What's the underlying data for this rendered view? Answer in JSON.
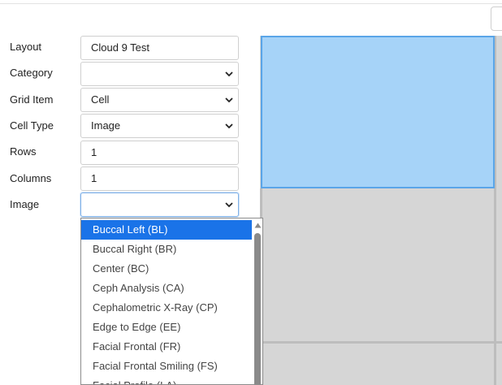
{
  "form": {
    "layout": {
      "label": "Layout",
      "value": "Cloud 9 Test"
    },
    "category": {
      "label": "Category",
      "value": ""
    },
    "grid_item": {
      "label": "Grid Item",
      "value": "Cell"
    },
    "cell_type": {
      "label": "Cell Type",
      "value": "Image"
    },
    "rows": {
      "label": "Rows",
      "value": "1"
    },
    "columns": {
      "label": "Columns",
      "value": "1"
    },
    "image": {
      "label": "Image",
      "value": ""
    }
  },
  "image_dropdown": {
    "options": [
      "Buccal Left (BL)",
      "Buccal Right (BR)",
      "Center (BC)",
      "Ceph Analysis (CA)",
      "Cephalometric X-Ray (CP)",
      "Edge to Edge (EE)",
      "Facial Frontal (FR)",
      "Facial Frontal Smiling (FS)",
      "Facial Profile (LA)"
    ],
    "highlighted_index": 0
  },
  "colors": {
    "selected_cell": "#a6d3f8",
    "selected_cell_border": "#5aa5e8",
    "grid_background": "#d6d6d6",
    "highlight": "#1a73e8"
  },
  "icons": {
    "select_arrow": "chevron-down-icon",
    "scroll_up": "triangle-up-icon"
  }
}
